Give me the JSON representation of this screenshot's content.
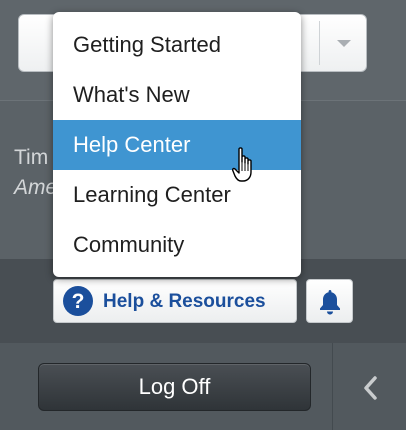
{
  "colors": {
    "menu_highlight": "#3f95d1",
    "help_text": "#1b4f9c",
    "logoff_bg": "#353a3e"
  },
  "timezone": {
    "label": "Tim",
    "value": "Ame"
  },
  "help_menu": {
    "items": [
      {
        "label": "Getting Started"
      },
      {
        "label": "What's New"
      },
      {
        "label": "Help Center",
        "hovered": true
      },
      {
        "label": "Learning Center"
      },
      {
        "label": "Community"
      }
    ]
  },
  "help_button": {
    "label": "Help & Resources",
    "icon": "question-circle-icon"
  },
  "notifications": {
    "icon": "bell-icon"
  },
  "footer": {
    "logoff_label": "Log Off",
    "collapse_icon": "chevron-left-icon"
  }
}
